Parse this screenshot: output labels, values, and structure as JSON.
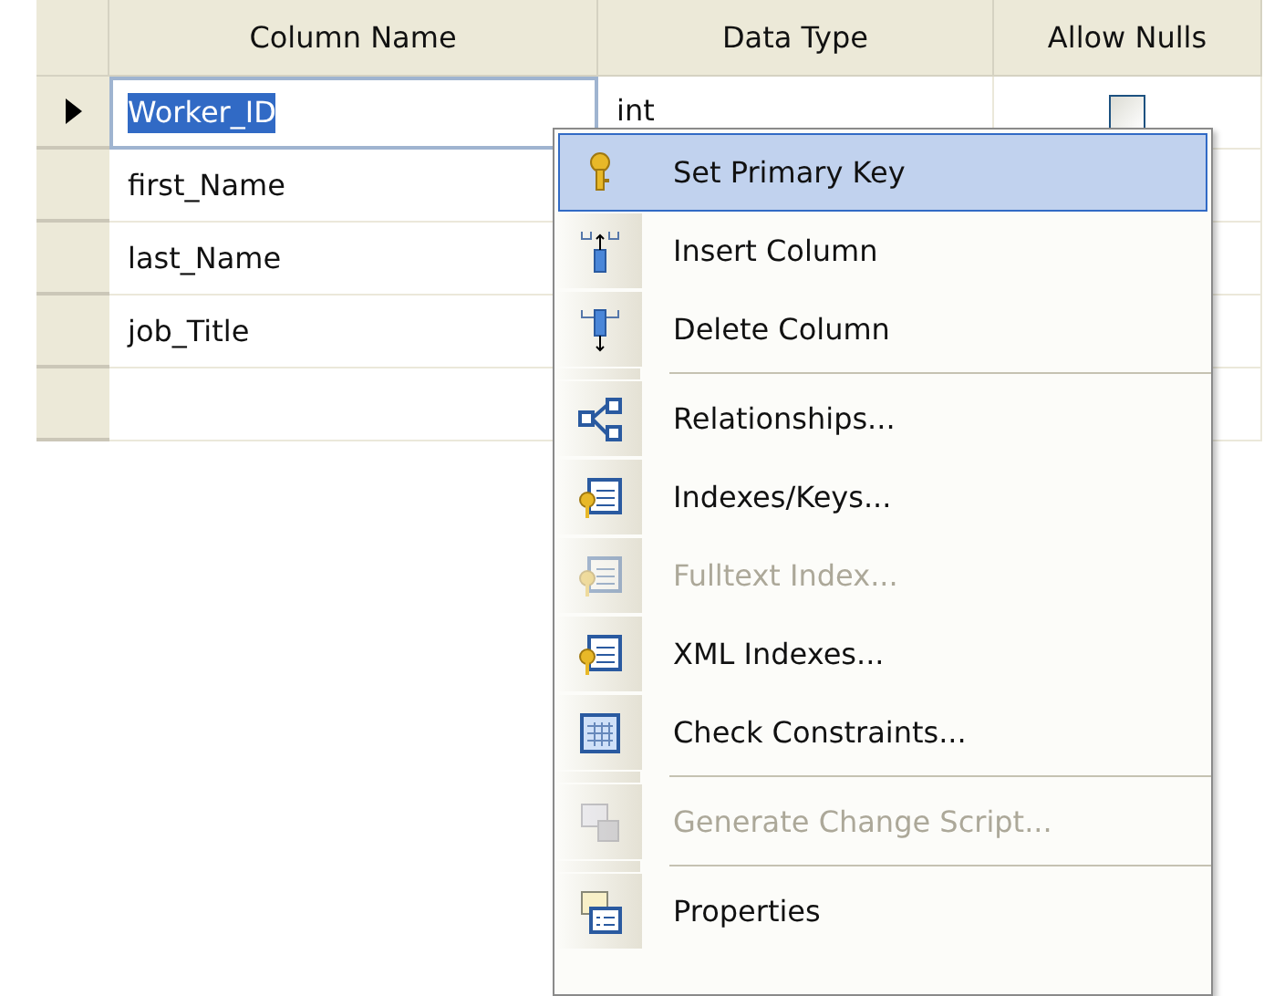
{
  "table": {
    "columns": [
      "Column Name",
      "Data Type",
      "Allow Nulls"
    ],
    "rows": [
      {
        "current": true,
        "column_name": "Worker_ID",
        "name_selected": true,
        "data_type": "int",
        "allow_nulls": false
      },
      {
        "current": false,
        "column_name": "first_Name",
        "name_selected": false
      },
      {
        "current": false,
        "column_name": "last_Name",
        "name_selected": false
      },
      {
        "current": false,
        "column_name": "job_Title",
        "name_selected": false
      }
    ]
  },
  "context_menu": {
    "items": [
      {
        "kind": "item",
        "label": "Set Primary Key",
        "disabled": false,
        "selected": true
      },
      {
        "kind": "item",
        "label": "Insert Column",
        "disabled": false,
        "selected": false
      },
      {
        "kind": "item",
        "label": "Delete Column",
        "disabled": false,
        "selected": false
      },
      {
        "kind": "separator"
      },
      {
        "kind": "item",
        "label": "Relationships...",
        "disabled": false,
        "selected": false
      },
      {
        "kind": "item",
        "label": "Indexes/Keys...",
        "disabled": false,
        "selected": false
      },
      {
        "kind": "item",
        "label": "Fulltext Index...",
        "disabled": true,
        "selected": false
      },
      {
        "kind": "item",
        "label": "XML Indexes...",
        "disabled": false,
        "selected": false
      },
      {
        "kind": "item",
        "label": "Check Constraints...",
        "disabled": false,
        "selected": false
      },
      {
        "kind": "separator"
      },
      {
        "kind": "item",
        "label": "Generate Change Script...",
        "disabled": true,
        "selected": false
      },
      {
        "kind": "separator"
      },
      {
        "kind": "item",
        "label": "Properties",
        "disabled": false,
        "selected": false
      }
    ]
  }
}
